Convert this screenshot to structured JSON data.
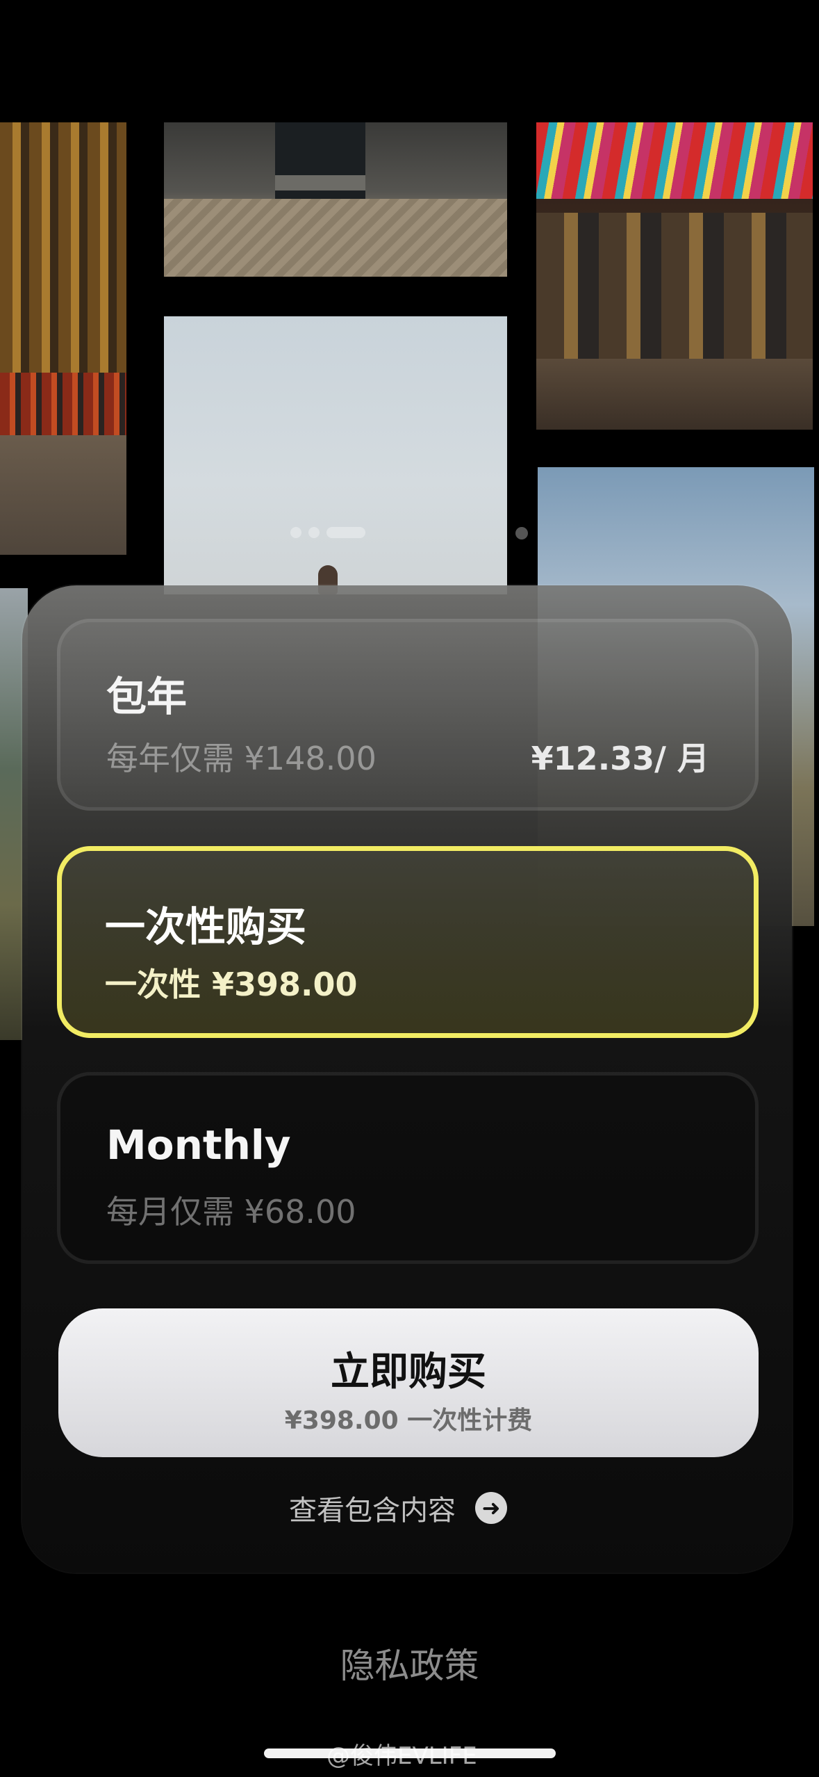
{
  "plans": {
    "yearly": {
      "title": "包年",
      "subtitle": "每年仅需 ¥148.00",
      "monthly_equivalent": "¥12.33/ 月"
    },
    "onetime": {
      "title": "一次性购买",
      "subtitle": "一次性 ¥398.00",
      "selected": true
    },
    "monthly": {
      "title": "Monthly",
      "subtitle": "每月仅需 ¥68.00"
    }
  },
  "buy_button": {
    "label": "立即购买",
    "sublabel": "¥398.00 一次性计费"
  },
  "see_included": {
    "label": "查看包含内容",
    "icon": "arrow-right-circle-icon"
  },
  "footer": {
    "privacy_label": "隐私政策"
  },
  "watermark": "@俊伟EVLIFE",
  "colors": {
    "selected_border": "#f2ec63",
    "button_bg": "#e8e8ea"
  }
}
